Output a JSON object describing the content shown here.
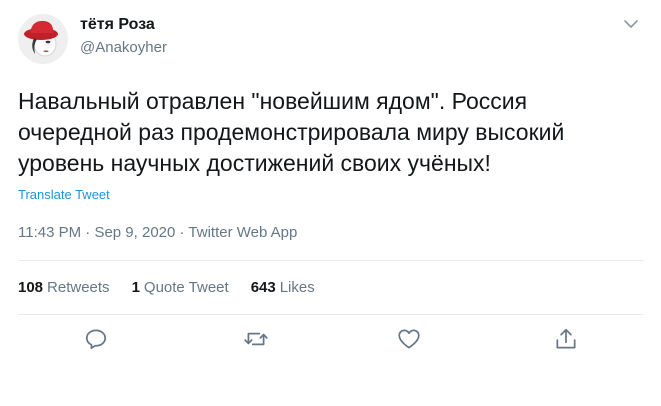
{
  "author": {
    "display_name": "тётя Роза",
    "handle": "@Anakoyher"
  },
  "tweet": {
    "text": "Навальный отравлен \"новейшим ядом\". Россия\nочередной раз продемонстрировала миру высокий\nуровень научных достижений своих учёных!",
    "translate_label": "Translate Tweet",
    "time": "11:43 PM",
    "date": "Sep 9, 2020",
    "separator": "·",
    "source": "Twitter Web App"
  },
  "stats": {
    "retweets_count": "108",
    "retweets_label": "Retweets",
    "quote_count": "1",
    "quote_label": "Quote Tweet",
    "likes_count": "643",
    "likes_label": "Likes"
  },
  "icons": {
    "caret": "chevron-down-icon",
    "reply": "reply-icon",
    "retweet": "retweet-icon",
    "like": "heart-icon",
    "share": "share-icon"
  },
  "colors": {
    "text": "#14171a",
    "secondary": "#657786",
    "link": "#1b95e0",
    "divider": "#e6ecf0"
  }
}
